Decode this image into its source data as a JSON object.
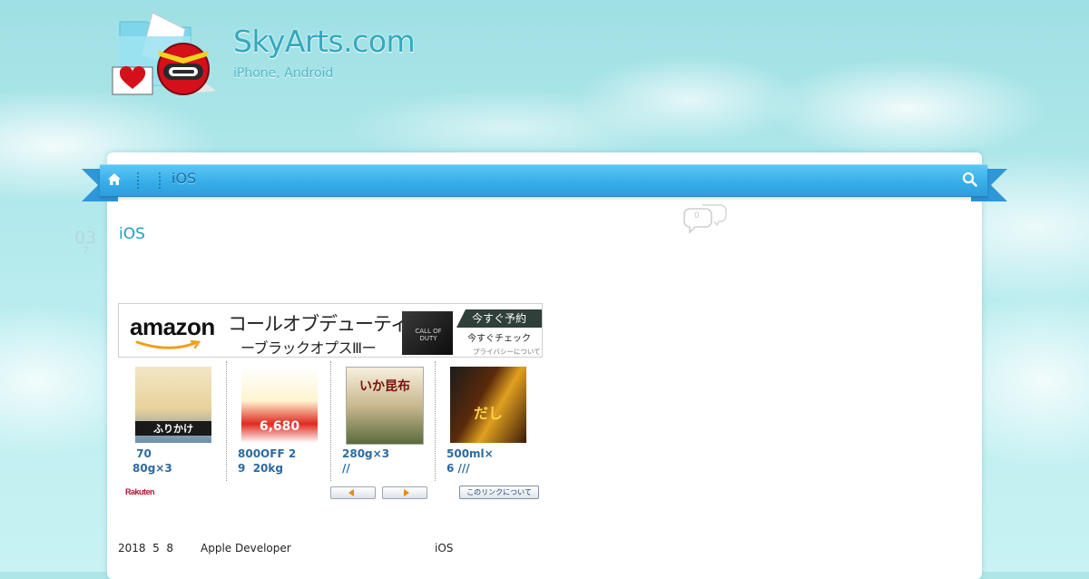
{
  "header": {
    "site_title": "SkyArts.com",
    "tagline": "iPhone, Android"
  },
  "nav": {
    "breadcrumb_label": "iOS",
    "icons": [
      "home-icon",
      "search-icon"
    ]
  },
  "post": {
    "date_day": "03",
    "date_month": "7",
    "title": "iOS",
    "comment_count": "0"
  },
  "amazon_ad": {
    "logo_text": "amazon",
    "title": "コールオブデューティ",
    "subtitle": "ーブラックオプスⅢー",
    "product_text": "CALL OF DUTY",
    "cta_label": "今すぐ予約",
    "check_label": "今すぐチェック",
    "privacy_label": "プライバシーについて"
  },
  "rakuten": {
    "items": [
      {
        "line1": " 70",
        "line2": "80g×3",
        "image_label": "ふりかけ"
      },
      {
        "line1": "800OFF 2",
        "line2": "9  20kg",
        "image_label": "6,680"
      },
      {
        "line1": "280g×3",
        "line2": "//",
        "image_label": "いか昆布"
      },
      {
        "line1": "500ml×",
        "line2": "6 ///",
        "image_label": "だし"
      }
    ],
    "logo_text": "Rakuten",
    "about_label": "このリンクについて"
  },
  "body_text": {
    "date": "2018  5  8",
    "source": "Apple Developer",
    "topic": "iOS"
  },
  "colors": {
    "nav_blue": "#37aee9",
    "title_teal": "#33a9bf",
    "link_blue": "#2b6aa0"
  }
}
